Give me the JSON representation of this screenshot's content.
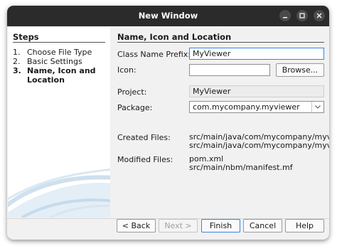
{
  "window": {
    "title": "New Window",
    "controls": {
      "minimize_icon": "minimize-icon",
      "maximize_icon": "maximize-icon",
      "close_icon": "close-icon"
    }
  },
  "steps": {
    "title": "Steps",
    "items": [
      {
        "number": "1.",
        "label": "Choose File Type",
        "current": false
      },
      {
        "number": "2.",
        "label": "Basic Settings",
        "current": false
      },
      {
        "number": "3.",
        "label": "Name, Icon and Location",
        "current": true
      }
    ]
  },
  "panel": {
    "title": "Name, Icon and Location",
    "class_name_prefix": {
      "label": "Class Name Prefix:",
      "value": "MyViewer"
    },
    "icon": {
      "label": "Icon:",
      "value": "",
      "browse_label": "Browse..."
    },
    "project": {
      "label": "Project:",
      "value": "MyViewer"
    },
    "package": {
      "label": "Package:",
      "value": "com.mycompany.myviewer"
    },
    "created_files": {
      "label": "Created Files:",
      "lines": [
        "src/main/java/com/mycompany/myviewer/",
        "src/main/java/com/mycompany/myviewer/"
      ]
    },
    "modified_files": {
      "label": "Modified Files:",
      "lines": [
        "pom.xml",
        "src/main/nbm/manifest.mf"
      ]
    }
  },
  "buttons": {
    "back": "< Back",
    "next": "Next >",
    "finish": "Finish",
    "cancel": "Cancel",
    "help": "Help"
  },
  "colors": {
    "titlebar": "#2b2b2b",
    "focus_accent": "#3584e4",
    "window_bg": "#f1f1f1"
  }
}
